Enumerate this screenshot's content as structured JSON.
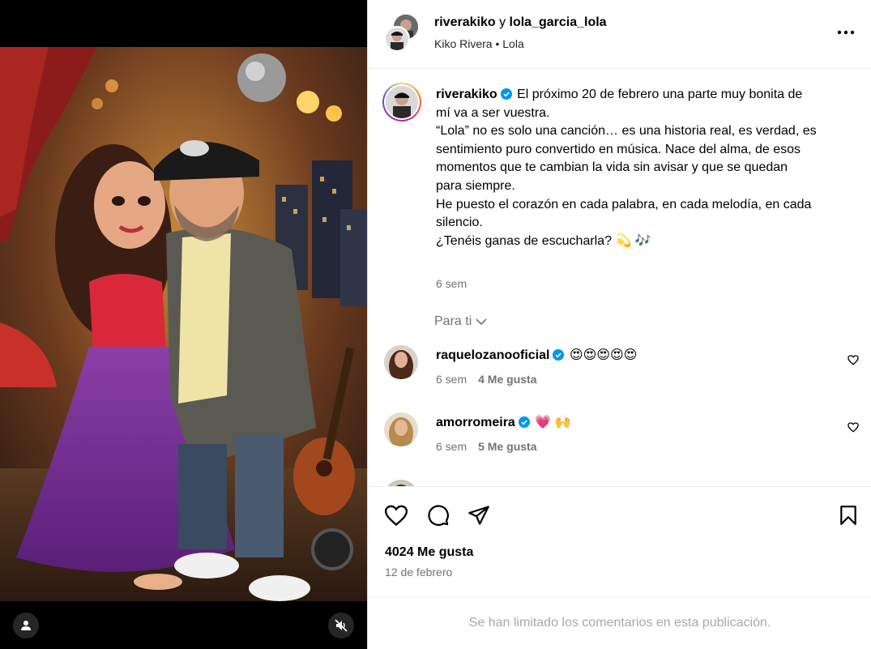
{
  "header": {
    "user1": "riverakiko",
    "connector": "y",
    "user2": "lola_garcia_lola",
    "subtitle": "Kiko Rivera • Lola"
  },
  "caption": {
    "username": "riverakiko",
    "lines": [
      "El próximo 20 de febrero una parte muy bonita de",
      "mí va a ser vuestra.",
      "“Lola” no es solo una canción… es una historia real, es verdad, es",
      "sentimiento puro convertido en música. Nace del alma, de esos",
      "momentos que te cambian la vida sin avisar y que se quedan",
      "para siempre.",
      "He puesto el corazón en cada palabra, en cada melodía, en cada",
      "silencio.",
      "",
      "¿Tenéis ganas de escucharla? 💫 🎶"
    ],
    "time": "6 sem"
  },
  "for_you_label": "Para ti",
  "comments": [
    {
      "username": "raquelozanooficial",
      "text": "😍😍😍😍😍",
      "time": "6 sem",
      "likes": "4 Me gusta"
    },
    {
      "username": "amorromeira",
      "text": "💗 🙌",
      "time": "6 sem",
      "likes": "5 Me gusta"
    }
  ],
  "actions": {
    "likes": "4024 Me gusta",
    "date": "12 de febrero"
  },
  "footer_text": "Se han limitado los comentarios en esta publicación.",
  "colors": {
    "verified": "#0095f6",
    "secondary_text": "#737373",
    "disabled_text": "#a8a8a8",
    "border": "#dbdbdb"
  },
  "icons": [
    "user-tag-icon",
    "muted-audio-icon",
    "more-options-icon",
    "verified-icon",
    "chevron-down-icon",
    "heart-icon",
    "comment-icon",
    "share-icon",
    "bookmark-icon"
  ]
}
